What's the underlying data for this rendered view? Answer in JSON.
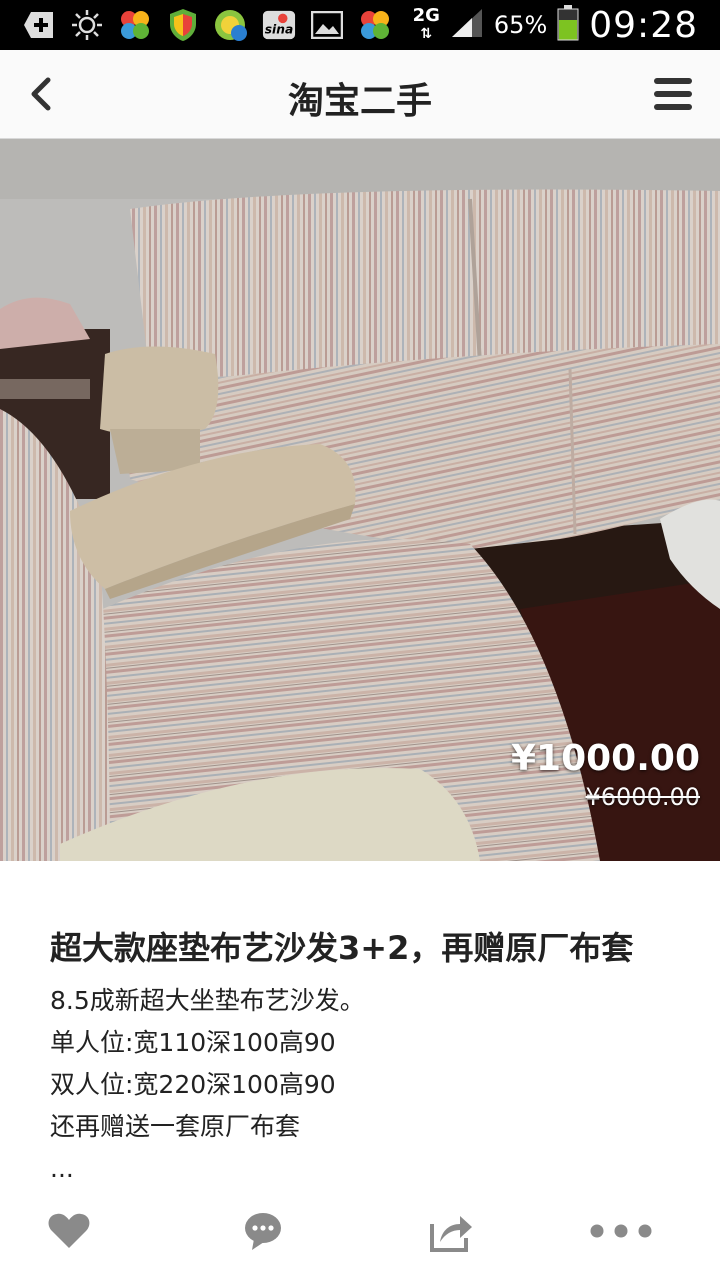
{
  "status_bar": {
    "icons": [
      "add-notification-icon",
      "brightness-icon",
      "clover-app-icon",
      "shield-app-icon",
      "globe-app-icon",
      "sina-app-icon",
      "gallery-icon",
      "clover-app-icon"
    ],
    "sina_text": "sina",
    "network": "2G",
    "battery_percent": "65%",
    "battery_level": 0.65,
    "time": "09:28"
  },
  "nav": {
    "title": "淘宝二手"
  },
  "listing": {
    "price": "¥1000.00",
    "original_price": "¥6000.00",
    "title": "超大款座垫布艺沙发3+2，再赠原厂布套",
    "description": [
      "8.5成新超大坐垫布艺沙发。",
      "单人位:宽110深100高90",
      "双人位:宽220深100高90",
      "还再赠送一套原厂布套",
      "..."
    ]
  },
  "colors": {
    "accent_icon": "#888888",
    "text": "#222222"
  }
}
